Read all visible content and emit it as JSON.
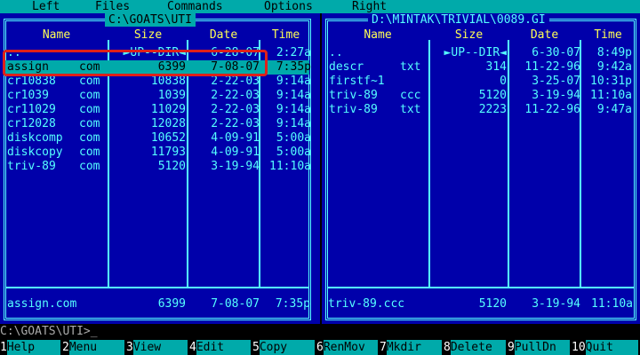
{
  "menu": [
    {
      "label": "Left"
    },
    {
      "label": "Files"
    },
    {
      "label": "Commands"
    },
    {
      "label": "Options"
    },
    {
      "label": "Right"
    }
  ],
  "left_panel": {
    "path": "C:\\GOATS\\UTI",
    "headers": {
      "name": "Name",
      "size": "Size",
      "date": "Date",
      "time": "Time"
    },
    "rows": [
      {
        "name": "..",
        "ext": "",
        "size": "►UP--DIR◄",
        "date": "6-28-07",
        "time": "2:27a"
      },
      {
        "name": "assign",
        "ext": "com",
        "size": "6399",
        "date": "7-08-07",
        "time": "7:35p"
      },
      {
        "name": "cr10838",
        "ext": "com",
        "size": "10838",
        "date": "2-22-03",
        "time": "9:14a"
      },
      {
        "name": "cr1039",
        "ext": "com",
        "size": "1039",
        "date": "2-22-03",
        "time": "9:14a"
      },
      {
        "name": "cr11029",
        "ext": "com",
        "size": "11029",
        "date": "2-22-03",
        "time": "9:14a"
      },
      {
        "name": "cr12028",
        "ext": "com",
        "size": "12028",
        "date": "2-22-03",
        "time": "9:14a"
      },
      {
        "name": "diskcomp",
        "ext": "com",
        "size": "10652",
        "date": "4-09-91",
        "time": "5:00a"
      },
      {
        "name": "diskcopy",
        "ext": "com",
        "size": "11793",
        "date": "4-09-91",
        "time": "5:00a"
      },
      {
        "name": "triv-89",
        "ext": "com",
        "size": "5120",
        "date": "3-19-94",
        "time": "11:10a"
      }
    ],
    "status": {
      "name": "assign.com",
      "size": "6399",
      "date": "7-08-07",
      "time": "7:35p"
    }
  },
  "right_panel": {
    "path": "D:\\MINTAK\\TRIVIAL\\0089.GI",
    "headers": {
      "name": "Name",
      "size": "Size",
      "date": "Date",
      "time": "Time"
    },
    "rows": [
      {
        "name": "..",
        "ext": "",
        "size": "►UP--DIR◄",
        "date": "6-30-07",
        "time": "8:49p"
      },
      {
        "name": "descr",
        "ext": "txt",
        "size": "314",
        "date": "11-22-96",
        "time": "9:42a"
      },
      {
        "name": "firstf~1",
        "ext": "",
        "size": "0",
        "date": "3-25-07",
        "time": "10:31p"
      },
      {
        "name": "triv-89",
        "ext": "ccc",
        "size": "5120",
        "date": "3-19-94",
        "time": "11:10a"
      },
      {
        "name": "triv-89",
        "ext": "txt",
        "size": "2223",
        "date": "11-22-96",
        "time": "9:47a"
      }
    ],
    "status": {
      "name": "triv-89.ccc",
      "size": "5120",
      "date": "3-19-94",
      "time": "11:10a"
    }
  },
  "command_line": "C:\\GOATS\\UTI>_",
  "fkeys": [
    {
      "num": "1",
      "label": "Help"
    },
    {
      "num": "2",
      "label": "Menu"
    },
    {
      "num": "3",
      "label": "View"
    },
    {
      "num": "4",
      "label": "Edit"
    },
    {
      "num": "5",
      "label": "Copy"
    },
    {
      "num": "6",
      "label": "RenMov"
    },
    {
      "num": "7",
      "label": "Mkdir"
    },
    {
      "num": "8",
      "label": "Delete"
    },
    {
      "num": "9",
      "label": "PullDn"
    },
    {
      "num": "10",
      "label": "Quit"
    }
  ],
  "colors": {
    "panel_bg": "#0000aa",
    "text": "#55ffff",
    "header": "#ffff55",
    "selection": "#00aaaa",
    "annotation": "#e0201a"
  }
}
